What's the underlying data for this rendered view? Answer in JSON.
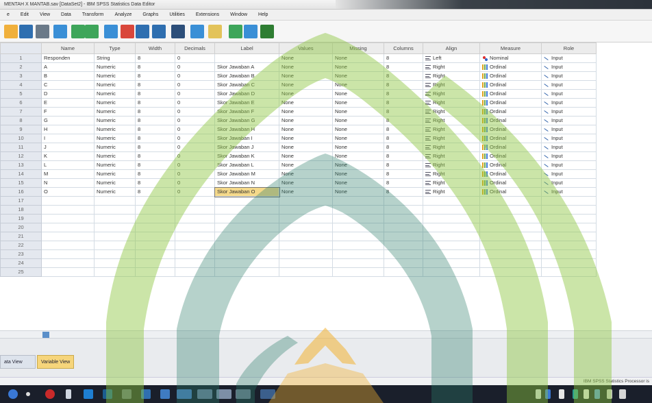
{
  "window": {
    "title": "MENTAH X MANTAB.sav [DataSet2] - IBM SPSS Statistics Data Editor"
  },
  "menu": [
    "e",
    "Edit",
    "View",
    "Data",
    "Transform",
    "Analyze",
    "Graphs",
    "Utilities",
    "Extensions",
    "Window",
    "Help"
  ],
  "toolbar_icons": [
    "open-icon",
    "save-icon",
    "print-icon",
    "dialog-recall-icon",
    "undo-icon",
    "redo-icon",
    "goto-case-icon",
    "goto-variable-icon",
    "variables-icon",
    "run-descriptives-icon",
    "find-icon",
    "insert-cases-icon",
    "insert-variable-icon",
    "split-file-icon",
    "value-labels-icon",
    "use-sets-icon"
  ],
  "grid": {
    "columns": [
      "Name",
      "Type",
      "Width",
      "Decimals",
      "Label",
      "Values",
      "Missing",
      "Columns",
      "Align",
      "Measure",
      "Role"
    ],
    "rows": [
      {
        "num": "1",
        "name": "Responden",
        "type": "String",
        "width": "8",
        "decimals": "0",
        "label": "",
        "values": "None",
        "missing": "None",
        "columns": "8",
        "align": "Left",
        "measure": "Nominal",
        "role": "Input"
      },
      {
        "num": "2",
        "name": "A",
        "type": "Numeric",
        "width": "8",
        "decimals": "0",
        "label": "Skor Jawaban A",
        "values": "None",
        "missing": "None",
        "columns": "8",
        "align": "Right",
        "measure": "Ordinal",
        "role": "Input"
      },
      {
        "num": "3",
        "name": "B",
        "type": "Numeric",
        "width": "8",
        "decimals": "0",
        "label": "Skor Jawaban B",
        "values": "None",
        "missing": "None",
        "columns": "8",
        "align": "Right",
        "measure": "Ordinal",
        "role": "Input"
      },
      {
        "num": "4",
        "name": "C",
        "type": "Numeric",
        "width": "8",
        "decimals": "0",
        "label": "Skor Jawaban C",
        "values": "None",
        "missing": "None",
        "columns": "8",
        "align": "Right",
        "measure": "Ordinal",
        "role": "Input"
      },
      {
        "num": "5",
        "name": "D",
        "type": "Numeric",
        "width": "8",
        "decimals": "0",
        "label": "Skor Jawaban D",
        "values": "None",
        "missing": "None",
        "columns": "8",
        "align": "Right",
        "measure": "Ordinal",
        "role": "Input"
      },
      {
        "num": "6",
        "name": "E",
        "type": "Numeric",
        "width": "8",
        "decimals": "0",
        "label": "Skor Jawaban E",
        "values": "None",
        "missing": "None",
        "columns": "8",
        "align": "Right",
        "measure": "Ordinal",
        "role": "Input"
      },
      {
        "num": "7",
        "name": "F",
        "type": "Numeric",
        "width": "8",
        "decimals": "0",
        "label": "Skor Jawaban F",
        "values": "None",
        "missing": "None",
        "columns": "8",
        "align": "Right",
        "measure": "Ordinal",
        "role": "Input"
      },
      {
        "num": "8",
        "name": "G",
        "type": "Numeric",
        "width": "8",
        "decimals": "0",
        "label": "Skor Jawaban G",
        "values": "None",
        "missing": "None",
        "columns": "8",
        "align": "Right",
        "measure": "Ordinal",
        "role": "Input"
      },
      {
        "num": "9",
        "name": "H",
        "type": "Numeric",
        "width": "8",
        "decimals": "0",
        "label": "Skor Jawaban H",
        "values": "None",
        "missing": "None",
        "columns": "8",
        "align": "Right",
        "measure": "Ordinal",
        "role": "Input"
      },
      {
        "num": "10",
        "name": "I",
        "type": "Numeric",
        "width": "8",
        "decimals": "0",
        "label": "Skor Jawaban I",
        "values": "None",
        "missing": "None",
        "columns": "8",
        "align": "Right",
        "measure": "Ordinal",
        "role": "Input"
      },
      {
        "num": "11",
        "name": "J",
        "type": "Numeric",
        "width": "8",
        "decimals": "0",
        "label": "Skor Jawaban J",
        "values": "None",
        "missing": "None",
        "columns": "8",
        "align": "Right",
        "measure": "Ordinal",
        "role": "Input"
      },
      {
        "num": "12",
        "name": "K",
        "type": "Numeric",
        "width": "8",
        "decimals": "0",
        "label": "Skor Jawaban K",
        "values": "None",
        "missing": "None",
        "columns": "8",
        "align": "Right",
        "measure": "Ordinal",
        "role": "Input"
      },
      {
        "num": "13",
        "name": "L",
        "type": "Numeric",
        "width": "8",
        "decimals": "0",
        "label": "Skor Jawaban L",
        "values": "None",
        "missing": "None",
        "columns": "8",
        "align": "Right",
        "measure": "Ordinal",
        "role": "Input"
      },
      {
        "num": "14",
        "name": "M",
        "type": "Numeric",
        "width": "8",
        "decimals": "0",
        "label": "Skor Jawaban M",
        "values": "None",
        "missing": "None",
        "columns": "8",
        "align": "Right",
        "measure": "Ordinal",
        "role": "Input"
      },
      {
        "num": "15",
        "name": "N",
        "type": "Numeric",
        "width": "8",
        "decimals": "0",
        "label": "Skor Jawaban N",
        "values": "None",
        "missing": "None",
        "columns": "8",
        "align": "Right",
        "measure": "Ordinal",
        "role": "Input"
      },
      {
        "num": "16",
        "name": "O",
        "type": "Numeric",
        "width": "8",
        "decimals": "0",
        "label": "Skor Jawaban O",
        "values": "None",
        "missing": "None",
        "columns": "8",
        "align": "Right",
        "measure": "Ordinal",
        "role": "Input"
      }
    ],
    "empty_rows": [
      "17",
      "18",
      "19",
      "20",
      "21",
      "22",
      "23",
      "24",
      "25"
    ],
    "selected_row": 16,
    "selected_column": "label"
  },
  "tabs": {
    "data_view": "ata View",
    "variable_view": "Variable View"
  },
  "status": {
    "processor": "IBM SPSS Statistics Processor is"
  },
  "colors": {
    "accent": "#f6d57b",
    "watermark_green": "#8cc63f",
    "watermark_teal": "#2e7d6b",
    "watermark_gold": "#f2b233"
  }
}
